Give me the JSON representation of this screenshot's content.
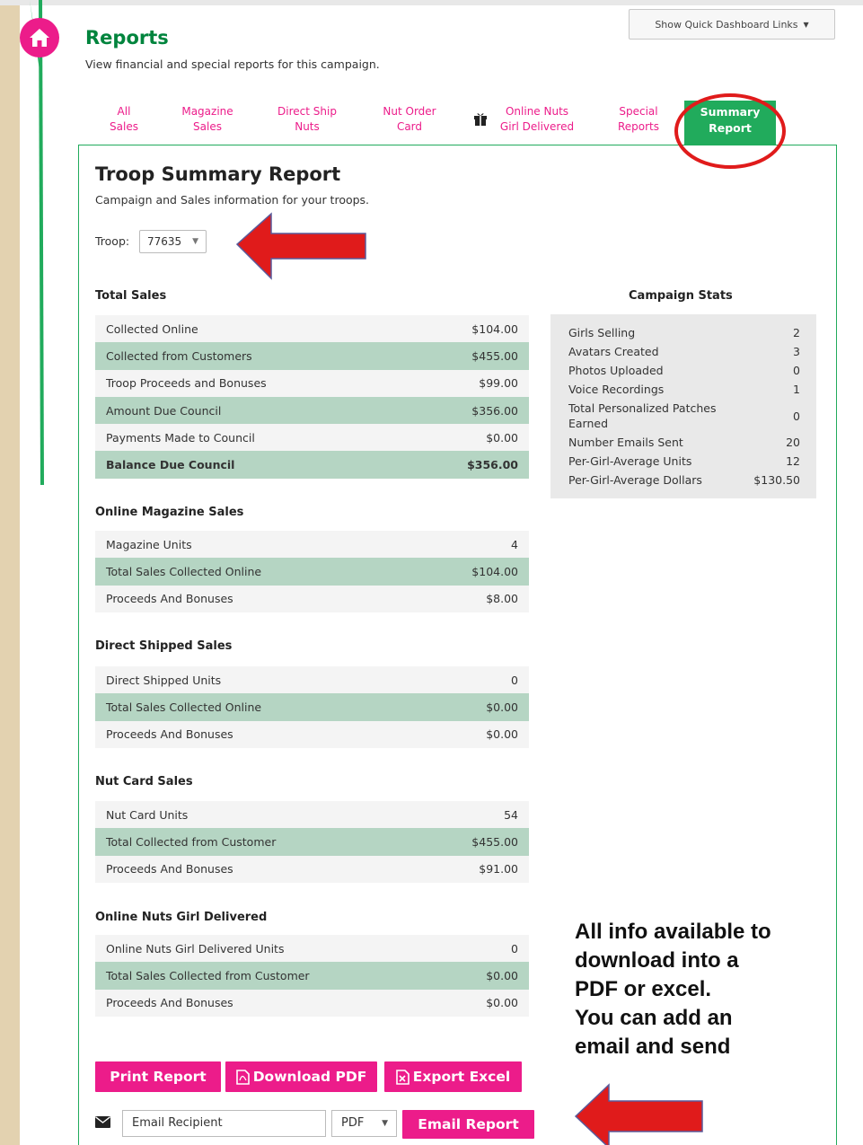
{
  "colors": {
    "brand_green": "#00843d",
    "tab_green": "#21ab5c",
    "accent_pink": "#ec1c8a",
    "row_green": "#b5d5c3",
    "annotation_red": "#e01b1b"
  },
  "header": {
    "title": "Reports",
    "subtitle": "View financial and special reports for this campaign.",
    "quick_links_label": "Show Quick Dashboard Links",
    "home_icon": "home-icon"
  },
  "tabs": [
    {
      "line1": "All",
      "line2": "Sales"
    },
    {
      "line1": "Magazine",
      "line2": "Sales"
    },
    {
      "line1": "Direct Ship",
      "line2": "Nuts"
    },
    {
      "line1": "Nut Order",
      "line2": "Card"
    },
    {
      "line1": "Online Nuts",
      "line2": "Girl Delivered"
    },
    {
      "line1": "Special",
      "line2": "Reports"
    },
    {
      "line1": "Summary",
      "line2": "Report",
      "active": true
    }
  ],
  "report": {
    "title": "Troop Summary Report",
    "subtitle": "Campaign and Sales information for your troops.",
    "troop_label": "Troop:",
    "troop_value": "77635"
  },
  "sections": {
    "total_sales": {
      "title": "Total Sales",
      "rows": [
        {
          "label": "Collected Online",
          "value": "$104.00"
        },
        {
          "label": "Collected from Customers",
          "value": "$455.00"
        },
        {
          "label": "Troop Proceeds and Bonuses",
          "value": "$99.00"
        },
        {
          "label": "Amount Due Council",
          "value": "$356.00"
        },
        {
          "label": "Payments Made to Council",
          "value": "$0.00"
        },
        {
          "label": "Balance Due Council",
          "value": "$356.00"
        }
      ]
    },
    "magazine": {
      "title": "Online Magazine Sales",
      "rows": [
        {
          "label": "Magazine Units",
          "value": "4"
        },
        {
          "label": "Total Sales Collected Online",
          "value": "$104.00"
        },
        {
          "label": "Proceeds And Bonuses",
          "value": "$8.00"
        }
      ]
    },
    "direct_shipped": {
      "title": "Direct Shipped Sales",
      "rows": [
        {
          "label": "Direct Shipped Units",
          "value": "0"
        },
        {
          "label": "Total Sales Collected Online",
          "value": "$0.00"
        },
        {
          "label": "Proceeds And Bonuses",
          "value": "$0.00"
        }
      ]
    },
    "nut_card": {
      "title": "Nut Card Sales",
      "rows": [
        {
          "label": "Nut Card Units",
          "value": "54"
        },
        {
          "label": "Total Collected from Customer",
          "value": "$455.00"
        },
        {
          "label": "Proceeds And Bonuses",
          "value": "$91.00"
        }
      ]
    },
    "online_nuts": {
      "title": "Online Nuts Girl Delivered",
      "rows": [
        {
          "label": "Online Nuts Girl Delivered Units",
          "value": "0"
        },
        {
          "label": "Total Sales Collected from Customer",
          "value": "$0.00"
        },
        {
          "label": "Proceeds And Bonuses",
          "value": "$0.00"
        }
      ]
    }
  },
  "campaign_stats": {
    "title": "Campaign Stats",
    "rows": [
      {
        "label": "Girls Selling",
        "value": "2"
      },
      {
        "label": "Avatars Created",
        "value": "3"
      },
      {
        "label": "Photos Uploaded",
        "value": "0"
      },
      {
        "label": "Voice Recordings",
        "value": "1"
      },
      {
        "label": "Total Personalized Patches Earned",
        "value": "0"
      },
      {
        "label": "Number Emails Sent",
        "value": "20"
      },
      {
        "label": "Per-Girl-Average Units",
        "value": "12"
      },
      {
        "label": "Per-Girl-Average Dollars",
        "value": "$130.50"
      }
    ]
  },
  "actions": {
    "print_label": "Print Report",
    "download_pdf_label": "Download PDF",
    "export_excel_label": "Export Excel",
    "email_placeholder": "Email Recipient",
    "format_value": "PDF",
    "email_report_label": "Email Report"
  },
  "annotation": {
    "line1": "All info available to",
    "line2": "download into a",
    "line3": "PDF or excel.",
    "line4": "You can add an",
    "line5": "email and send"
  }
}
